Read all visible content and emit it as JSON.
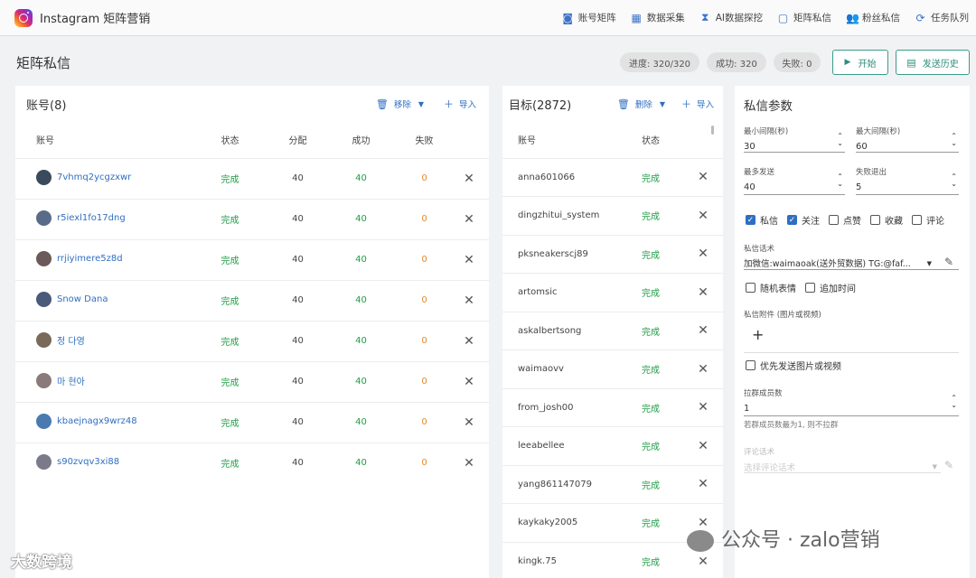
{
  "app": {
    "title": "Instagram 矩阵营销"
  },
  "nav": [
    {
      "label": "账号矩阵",
      "icon": "account-matrix-icon",
      "glyph": "◙"
    },
    {
      "label": "数据采集",
      "icon": "grid-icon",
      "glyph": "▦"
    },
    {
      "label": "AI数据探挖",
      "icon": "hourglass-icon",
      "glyph": "⧗"
    },
    {
      "label": "矩阵私信",
      "icon": "chat-icon",
      "glyph": "▢"
    },
    {
      "label": "粉丝私信",
      "icon": "people-icon",
      "glyph": "👥"
    },
    {
      "label": "任务队列",
      "icon": "refresh-icon",
      "glyph": "⟳"
    }
  ],
  "page": {
    "title": "矩阵私信",
    "progress_label": "进度: 320/320",
    "success_label": "成功: 320",
    "fail_label": "失败: 0",
    "start_label": "开始",
    "history_label": "发送历史"
  },
  "accounts": {
    "title": "账号(8)",
    "remove_label": "移除",
    "import_label": "导入",
    "headers": [
      "账号",
      "状态",
      "分配",
      "成功",
      "失败"
    ],
    "rows": [
      {
        "name": "7vhmq2ycgzxwr",
        "status": "完成",
        "alloc": "40",
        "success": "40",
        "fail": "0",
        "avatar_color": "#3a4a5c"
      },
      {
        "name": "r5iexl1fo17dng",
        "status": "完成",
        "alloc": "40",
        "success": "40",
        "fail": "0",
        "avatar_color": "#5a6b8a"
      },
      {
        "name": "rrjiyimere5z8d",
        "status": "完成",
        "alloc": "40",
        "success": "40",
        "fail": "0",
        "avatar_color": "#6a5a5a"
      },
      {
        "name": "Snow Dana",
        "status": "完成",
        "alloc": "40",
        "success": "40",
        "fail": "0",
        "avatar_color": "#4a5a7a"
      },
      {
        "name": "정 다영",
        "status": "完成",
        "alloc": "40",
        "success": "40",
        "fail": "0",
        "avatar_color": "#7a6a5a"
      },
      {
        "name": "마 현아",
        "status": "完成",
        "alloc": "40",
        "success": "40",
        "fail": "0",
        "avatar_color": "#8a7a7a"
      },
      {
        "name": "kbaejnagx9wrz48",
        "status": "完成",
        "alloc": "40",
        "success": "40",
        "fail": "0",
        "avatar_color": "#4a7ab0"
      },
      {
        "name": "s90zvqv3xi88",
        "status": "完成",
        "alloc": "40",
        "success": "40",
        "fail": "0",
        "avatar_color": "#7a7a8a"
      }
    ]
  },
  "targets": {
    "title": "目标(2872)",
    "delete_label": "删除",
    "import_label": "导入",
    "headers": [
      "账号",
      "状态"
    ],
    "rows": [
      {
        "name": "anna601066",
        "status": "完成"
      },
      {
        "name": "dingzhitui_system",
        "status": "完成"
      },
      {
        "name": "pksneakerscj89",
        "status": "完成"
      },
      {
        "name": "artomsic",
        "status": "完成"
      },
      {
        "name": "askalbertsong",
        "status": "完成"
      },
      {
        "name": "waimaovv",
        "status": "完成"
      },
      {
        "name": "from_josh00",
        "status": "完成"
      },
      {
        "name": "leeabellee",
        "status": "完成"
      },
      {
        "name": "yang861147079",
        "status": "完成"
      },
      {
        "name": "kaykaky2005",
        "status": "完成"
      },
      {
        "name": "kingk.75",
        "status": "完成"
      }
    ]
  },
  "params": {
    "title": "私信参数",
    "min_interval_label": "最小间隔(秒)",
    "min_interval_value": "30",
    "max_interval_label": "最大间隔(秒)",
    "max_interval_value": "60",
    "max_send_label": "最多发送",
    "max_send_value": "40",
    "fail_exit_label": "失败退出",
    "fail_exit_value": "5",
    "checkboxes": [
      {
        "label": "私信",
        "checked": true
      },
      {
        "label": "关注",
        "checked": true
      },
      {
        "label": "点赞",
        "checked": false
      },
      {
        "label": "收藏",
        "checked": false
      },
      {
        "label": "评论",
        "checked": false
      }
    ],
    "script_label": "私信话术",
    "script_value": "加微信:waimaoak(送外贸数据)  TG:@faf...",
    "random_emoji_label": "随机表情",
    "append_time_label": "追加时间",
    "attachment_label": "私信附件 (图片或视频)",
    "priority_media_label": "优先发送图片或视频",
    "group_label": "拉群成员数",
    "group_value": "1",
    "group_hint": "若群成员数最为1, 则不拉群",
    "comment_label": "评论话术",
    "comment_placeholder": "选择评论话术"
  },
  "watermarks": {
    "left": "大数跨境",
    "right": "公众号 · zalo营销"
  }
}
